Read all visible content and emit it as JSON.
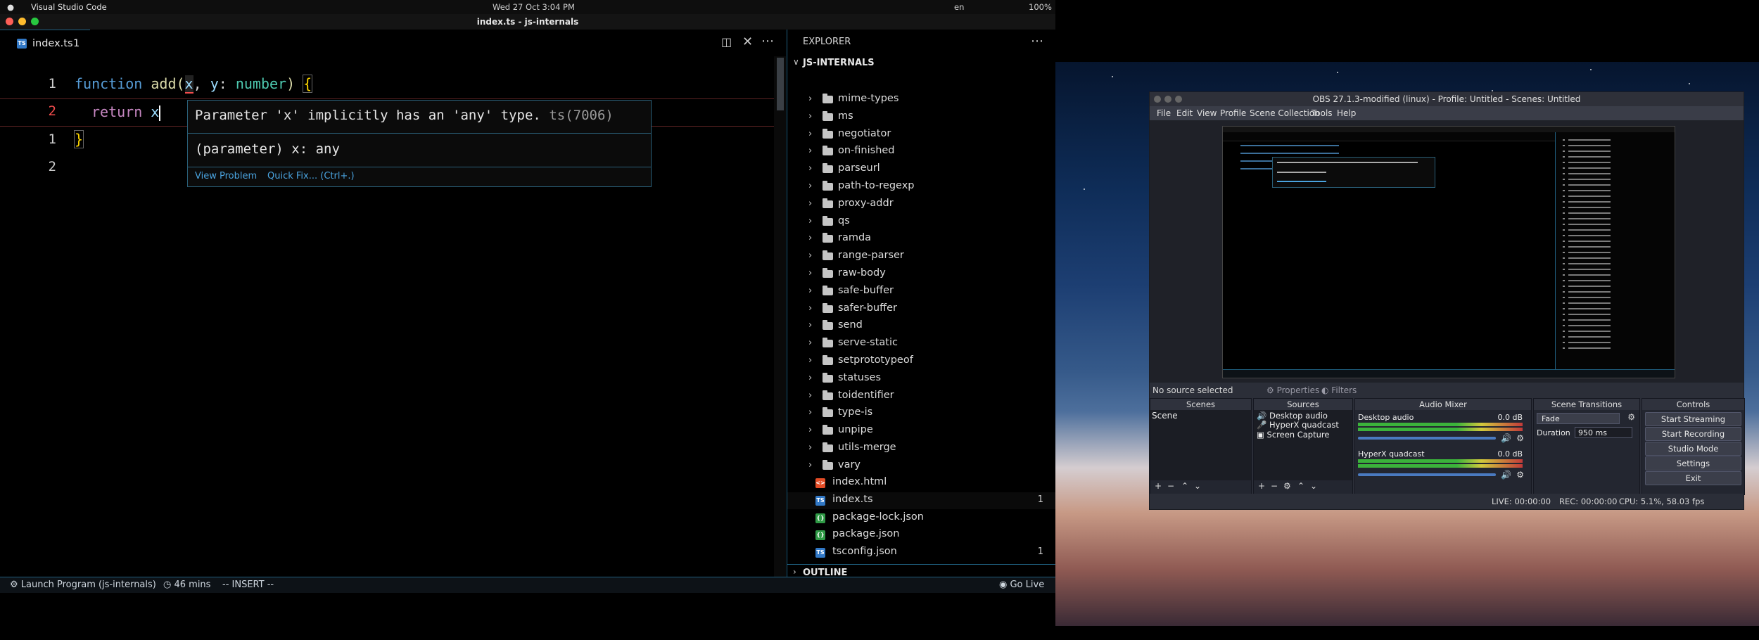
{
  "menubar": {
    "app_name": "Visual Studio Code",
    "datetime": "Wed 27 Oct  3:04 PM",
    "lang": "en",
    "battery": "100%"
  },
  "vscode": {
    "window_title": "index.ts - js-internals",
    "tab": {
      "name": "index.ts",
      "badge": "1"
    },
    "code_lines": [
      {
        "num": "1",
        "text": "function add(x, y: number) {"
      },
      {
        "num": "2",
        "text": "return x"
      },
      {
        "num": "1",
        "text": "}"
      },
      {
        "num": "2",
        "text": ""
      }
    ],
    "code_tokens": {
      "keyword_function": "function",
      "fn_name": "add",
      "paren_open": "(",
      "param_x": "x",
      "comma": ",",
      "param_y": "y",
      "colon": ":",
      "type_number": "number",
      "paren_close": ")",
      "brace_open": "{",
      "keyword_return": "return",
      "return_x": "x",
      "brace_close": "}"
    },
    "hover": {
      "message": "Parameter 'x' implicitly has an 'any' type.",
      "code": "ts(7006)",
      "signature": "(parameter) x: any",
      "action_view": "View Problem",
      "action_fix": "Quick Fix... (Ctrl+.)"
    },
    "explorer": {
      "title": "EXPLORER",
      "root": "JS-INTERNALS",
      "folders": [
        "mime-types",
        "ms",
        "negotiator",
        "on-finished",
        "parseurl",
        "path-to-regexp",
        "proxy-addr",
        "qs",
        "ramda",
        "range-parser",
        "raw-body",
        "safe-buffer",
        "safer-buffer",
        "send",
        "serve-static",
        "setprototypeof",
        "statuses",
        "toidentifier",
        "type-is",
        "unpipe",
        "utils-merge",
        "vary"
      ],
      "files": [
        {
          "name": "index.html",
          "icon": "html-icon",
          "badge": ""
        },
        {
          "name": "index.ts",
          "icon": "ts-icon",
          "badge": "1"
        },
        {
          "name": "package-lock.json",
          "icon": "json-icon",
          "badge": ""
        },
        {
          "name": "package.json",
          "icon": "json-icon",
          "badge": ""
        },
        {
          "name": "tsconfig.json",
          "icon": "tsconfig-icon",
          "badge": "1"
        }
      ],
      "outline": "OUTLINE"
    },
    "statusbar": {
      "launch": "Launch Program (js-internals)",
      "time": "46 mins",
      "mode": "-- INSERT --",
      "golive": "Go Live"
    }
  },
  "obs": {
    "title": "OBS 27.1.3-modified (linux) - Profile: Untitled - Scenes: Untitled",
    "menu": [
      "File",
      "Edit",
      "View",
      "Profile",
      "Scene Collection",
      "Tools",
      "Help"
    ],
    "no_source": "No source selected",
    "properties": "Properties",
    "filters": "Filters",
    "scenes": {
      "title": "Scenes",
      "items": [
        "Scene"
      ]
    },
    "sources": {
      "title": "Sources",
      "items": [
        "Desktop audio",
        "HyperX quadcast",
        "Screen Capture"
      ]
    },
    "audio": {
      "title": "Audio Mixer",
      "channels": [
        {
          "name": "Desktop audio",
          "db": "0.0 dB"
        },
        {
          "name": "HyperX quadcast",
          "db": "0.0 dB"
        }
      ]
    },
    "transitions": {
      "title": "Scene Transitions",
      "type": "Fade",
      "duration_label": "Duration",
      "duration": "950 ms"
    },
    "controls": {
      "title": "Controls",
      "buttons": [
        "Start Streaming",
        "Start Recording",
        "Studio Mode",
        "Settings",
        "Exit"
      ]
    },
    "status": {
      "live": "LIVE: 00:00:00",
      "rec": "REC: 00:00:00",
      "cpu": "CPU: 5.1%, 58.03 fps"
    }
  },
  "colors": {
    "keyword": "#569cd6",
    "fn": "#dcdcaa",
    "type": "#4ec9b0",
    "param": "#9cdcfe",
    "error": "#f14c4c",
    "accent": "#1f5f7f"
  }
}
